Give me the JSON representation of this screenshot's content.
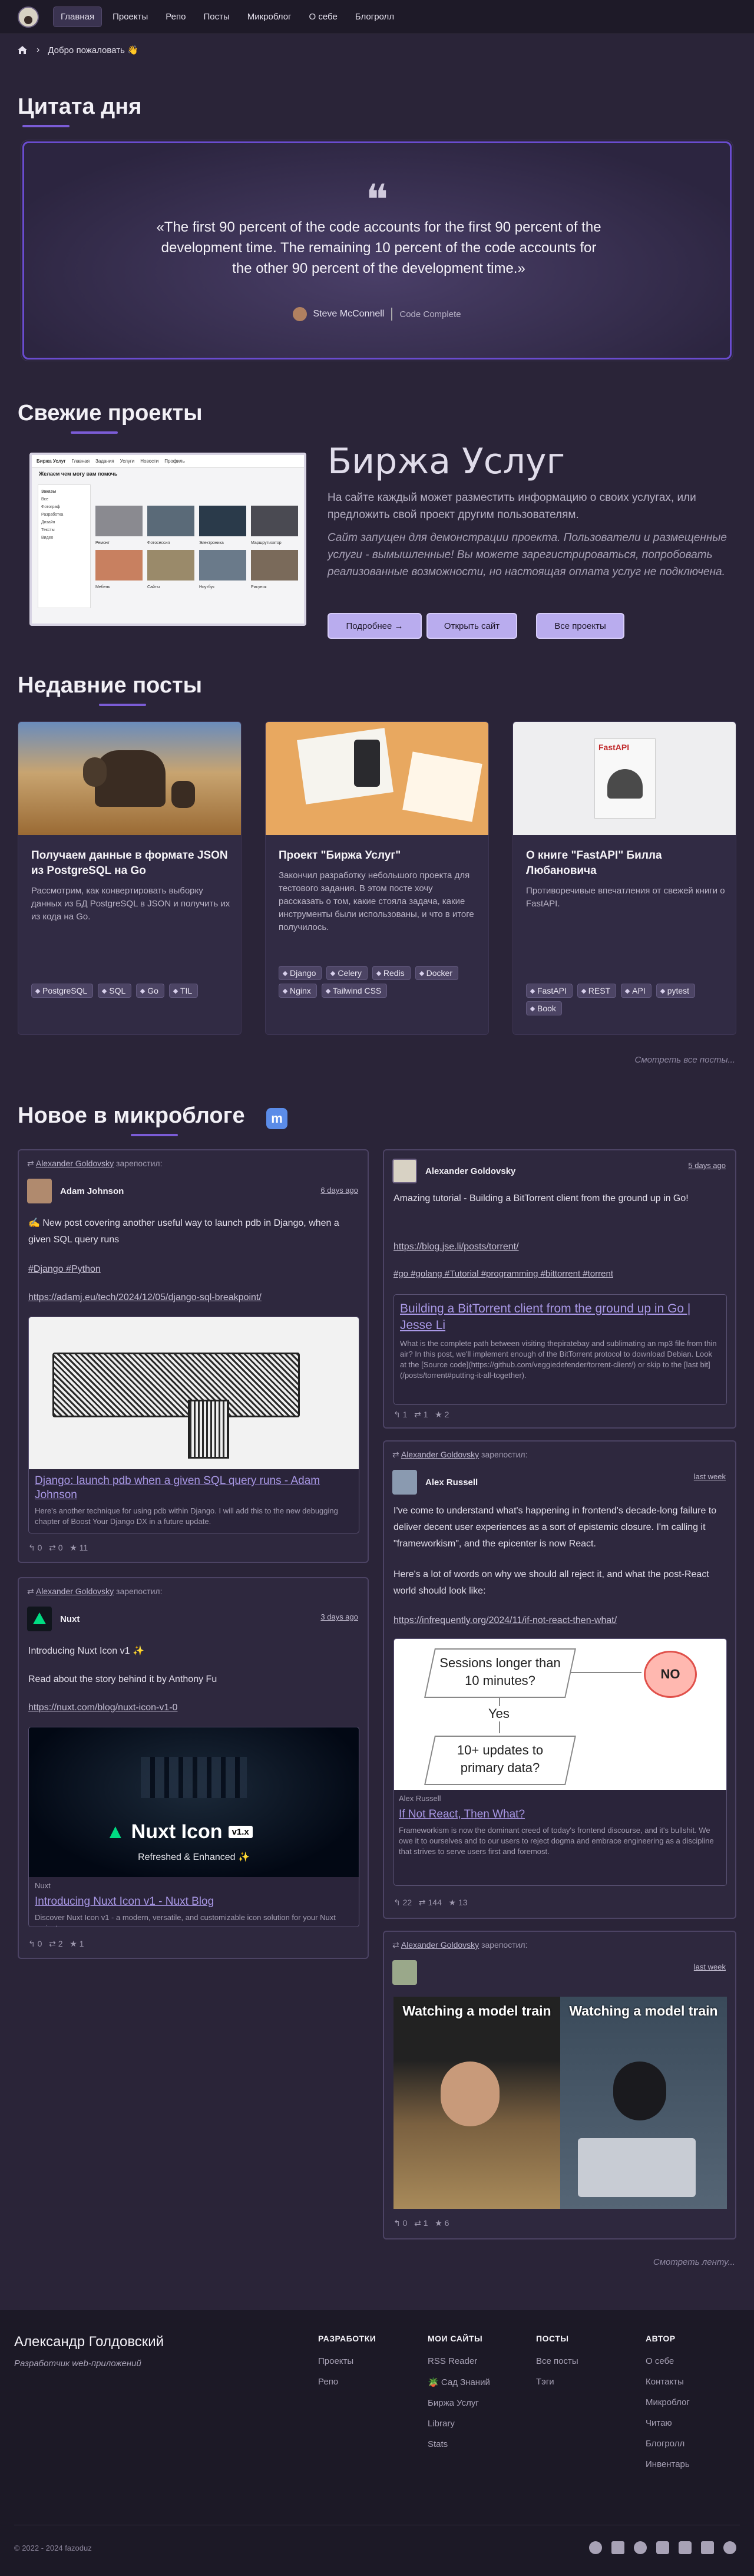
{
  "nav": {
    "items": [
      "Главная",
      "Проекты",
      "Репо",
      "Посты",
      "Микроблог",
      "О себе",
      "Блогролл"
    ]
  },
  "breadcrumb": {
    "current": "Добро пожаловать 👋"
  },
  "quote": {
    "heading": "Цитата дня",
    "text": "«The first 90 percent of the code accounts for the first 90 percent of the development time. The remaining 10 percent of the code accounts for the other 90 percent of the development time.»",
    "author": "Steve McConnell",
    "source": "Code Complete"
  },
  "projects": {
    "heading": "Свежие проекты",
    "title": "Биржа Услуг",
    "description": "На сайте каждый может разместить информацию о своих услугах, или предложить свой проект другим пользователям.",
    "note": "Сайт запущен для демонстрации проекта. Пользователи и размещенные услуги - вымышленные! Вы можете зарегистрироваться, попробовать реализованные возможности, но настоящая оплата услуг не подключена.",
    "btn_more": "Подробнее →",
    "btn_open": "Открыть сайт",
    "btn_all": "Все проекты",
    "screenshot": {
      "site_name": "Биржа Услуг",
      "nav": [
        "Главная",
        "Задания",
        "Услуги",
        "Новости",
        "Профиль"
      ],
      "heading": "Желаем чем могу вам помочь",
      "sidebar_title": "Заказы",
      "sidebar_items": [
        "Все",
        "Фотограф",
        "Разработка",
        "Дизайн",
        "Тексты",
        "Видео"
      ],
      "cards": [
        "Ремонт",
        "Фотосессия",
        "Электроника",
        "Маршрутизатор",
        "Мебель",
        "Сайты",
        "Ноутбук",
        "Рисунок"
      ]
    }
  },
  "posts": {
    "heading": "Недавние посты",
    "items": [
      {
        "title": "Получаем данные в формате JSON из PostgreSQL на Go",
        "excerpt": "Рассмотрим, как конвертировать выборку данных из БД PostgreSQL в JSON и получить их из кода на Go.",
        "tags": [
          "PostgreSQL",
          "SQL",
          "Go",
          "TIL"
        ]
      },
      {
        "title": "Проект \"Биржа Услуг\"",
        "excerpt": "Закончил разработку небольшого проекта для тестового задания. В этом посте хочу рассказать о том, какие стояла задача, какие инструменты были использованы, и что в итоге получилось.",
        "tags": [
          "Django",
          "Celery",
          "Redis",
          "Docker",
          "Nginx",
          "Tailwind CSS"
        ]
      },
      {
        "title": "О книге \"FastAPI\" Билла Любановича",
        "excerpt": "Противоречивые впечатления от свежей книги о FastAPI.",
        "tags": [
          "FastAPI",
          "REST",
          "API",
          "pytest",
          "Book"
        ],
        "book_title": "FastAPI"
      }
    ],
    "more": "Смотреть все посты..."
  },
  "microblog": {
    "heading": "Новое в микроблоге",
    "boost_author": "Alexander Goldovsky",
    "boost_suffix": "зарепостил:",
    "posts": [
      {
        "boosted": true,
        "author": "Adam Johnson",
        "date": "6 days ago",
        "text": "✍️ New post covering another useful way to launch pdb in Django, when a given SQL query runs",
        "hashtags": "#Django #Python",
        "link": "https://adamj.eu/tech/2024/12/05/django-sql-breakpoint/",
        "preview_title": "Django: launch pdb when a given SQL query runs - Adam Johnson",
        "preview_desc": "Here's another technique for using pdb within Django. I will add this to the new debugging chapter of Boost Your Django DX in a future update.",
        "stats": [
          "0",
          "0",
          "11"
        ]
      },
      {
        "boosted": true,
        "author": "Nuxt",
        "date": "3 days ago",
        "text1": "Introducing Nuxt Icon v1 ✨",
        "text2": "Read about the story behind it by Anthony Fu",
        "link": "https://nuxt.com/blog/nuxt-icon-v1-0",
        "banner_title": "Nuxt Icon",
        "banner_version": "v1.x",
        "banner_sub": "Refreshed & Enhanced ✨",
        "preview_site": "Nuxt",
        "preview_title": "Introducing Nuxt Icon v1 - Nuxt Blog",
        "preview_desc": "Discover Nuxt Icon v1 - a modern, versatile, and customizable icon solution for your Nuxt projects.",
        "stats": [
          "0",
          "2",
          "1"
        ]
      },
      {
        "boosted": false,
        "author": "Alexander Goldovsky",
        "date": "5 days ago",
        "text": "Amazing tutorial - Building a BitTorrent client from the ground up in Go!",
        "link": "https://blog.jse.li/posts/torrent/",
        "hashtags": "#go #golang #Tutorial #programming #bittorrent #torrent",
        "preview_title": "Building a BitTorrent client from the ground up in Go | Jesse Li",
        "preview_desc": "What is the complete path between visiting thepiratebay and sublimating an mp3 file from thin air? In this post, we'll implement enough of the BitTorrent protocol to download Debian. Look at the [Source code](https://github.com/veggiedefender/torrent-client/) or skip to the [last bit](/posts/torrent#putting-it-all-together).",
        "stats": [
          "1",
          "1",
          "2"
        ]
      },
      {
        "boosted": true,
        "author": "Alex Russell",
        "date": "last week",
        "text1": "I've come to understand what's happening in frontend's decade-long failure to deliver decent user experiences as a sort of epistemic closure. I'm calling it \"frameworkism\", and the epicenter is now React.",
        "text2": "Here's a lot of words on why we should all reject it, and what the post-React world should look like:",
        "link": "https://infrequently.org/2024/11/if-not-react-then-what/",
        "flow_q1": "Sessions longer than 10 minutes?",
        "flow_no": "NO",
        "flow_yes": "Yes",
        "flow_q2": "10+ updates to primary data?",
        "preview_site": "Alex Russell",
        "preview_title": "If Not React, Then What?",
        "preview_desc": "Frameworkism is now the dominant creed of today's frontend discourse, and it's bullshit. We owe it to ourselves and to our users to reject dogma and embrace engineering as a discipline that strives to serve users first and foremost.",
        "stats": [
          "22",
          "144",
          "13"
        ]
      },
      {
        "boosted": true,
        "author": "",
        "date": "last week",
        "meme_left": "Watching a model train",
        "meme_right": "Watching a model train",
        "stats": [
          "0",
          "1",
          "6"
        ]
      }
    ],
    "more": "Смотреть ленту..."
  },
  "footer": {
    "name": "Александр Голдовский",
    "role": "Разработчик web-приложений",
    "cols": [
      {
        "title": "РАЗРАБОТКИ",
        "items": [
          "Проекты",
          "Репо"
        ]
      },
      {
        "title": "МОИ САЙТЫ",
        "items": [
          "RSS Reader",
          "🪴 Сад Знаний",
          "Биржа Услуг",
          "Library",
          "Stats"
        ]
      },
      {
        "title": "ПОСТЫ",
        "items": [
          "Все посты",
          "Тэги"
        ]
      },
      {
        "title": "АВТОР",
        "items": [
          "О себе",
          "Контакты",
          "Микроблог",
          "Читаю",
          "Блогролл",
          "Инвентарь"
        ]
      }
    ],
    "copyright": "© 2022 - 2024 fazoduz"
  },
  "colors": {
    "accent": "#7b5cd6",
    "bg": "#2a2438",
    "nav": "#1e1a28"
  }
}
